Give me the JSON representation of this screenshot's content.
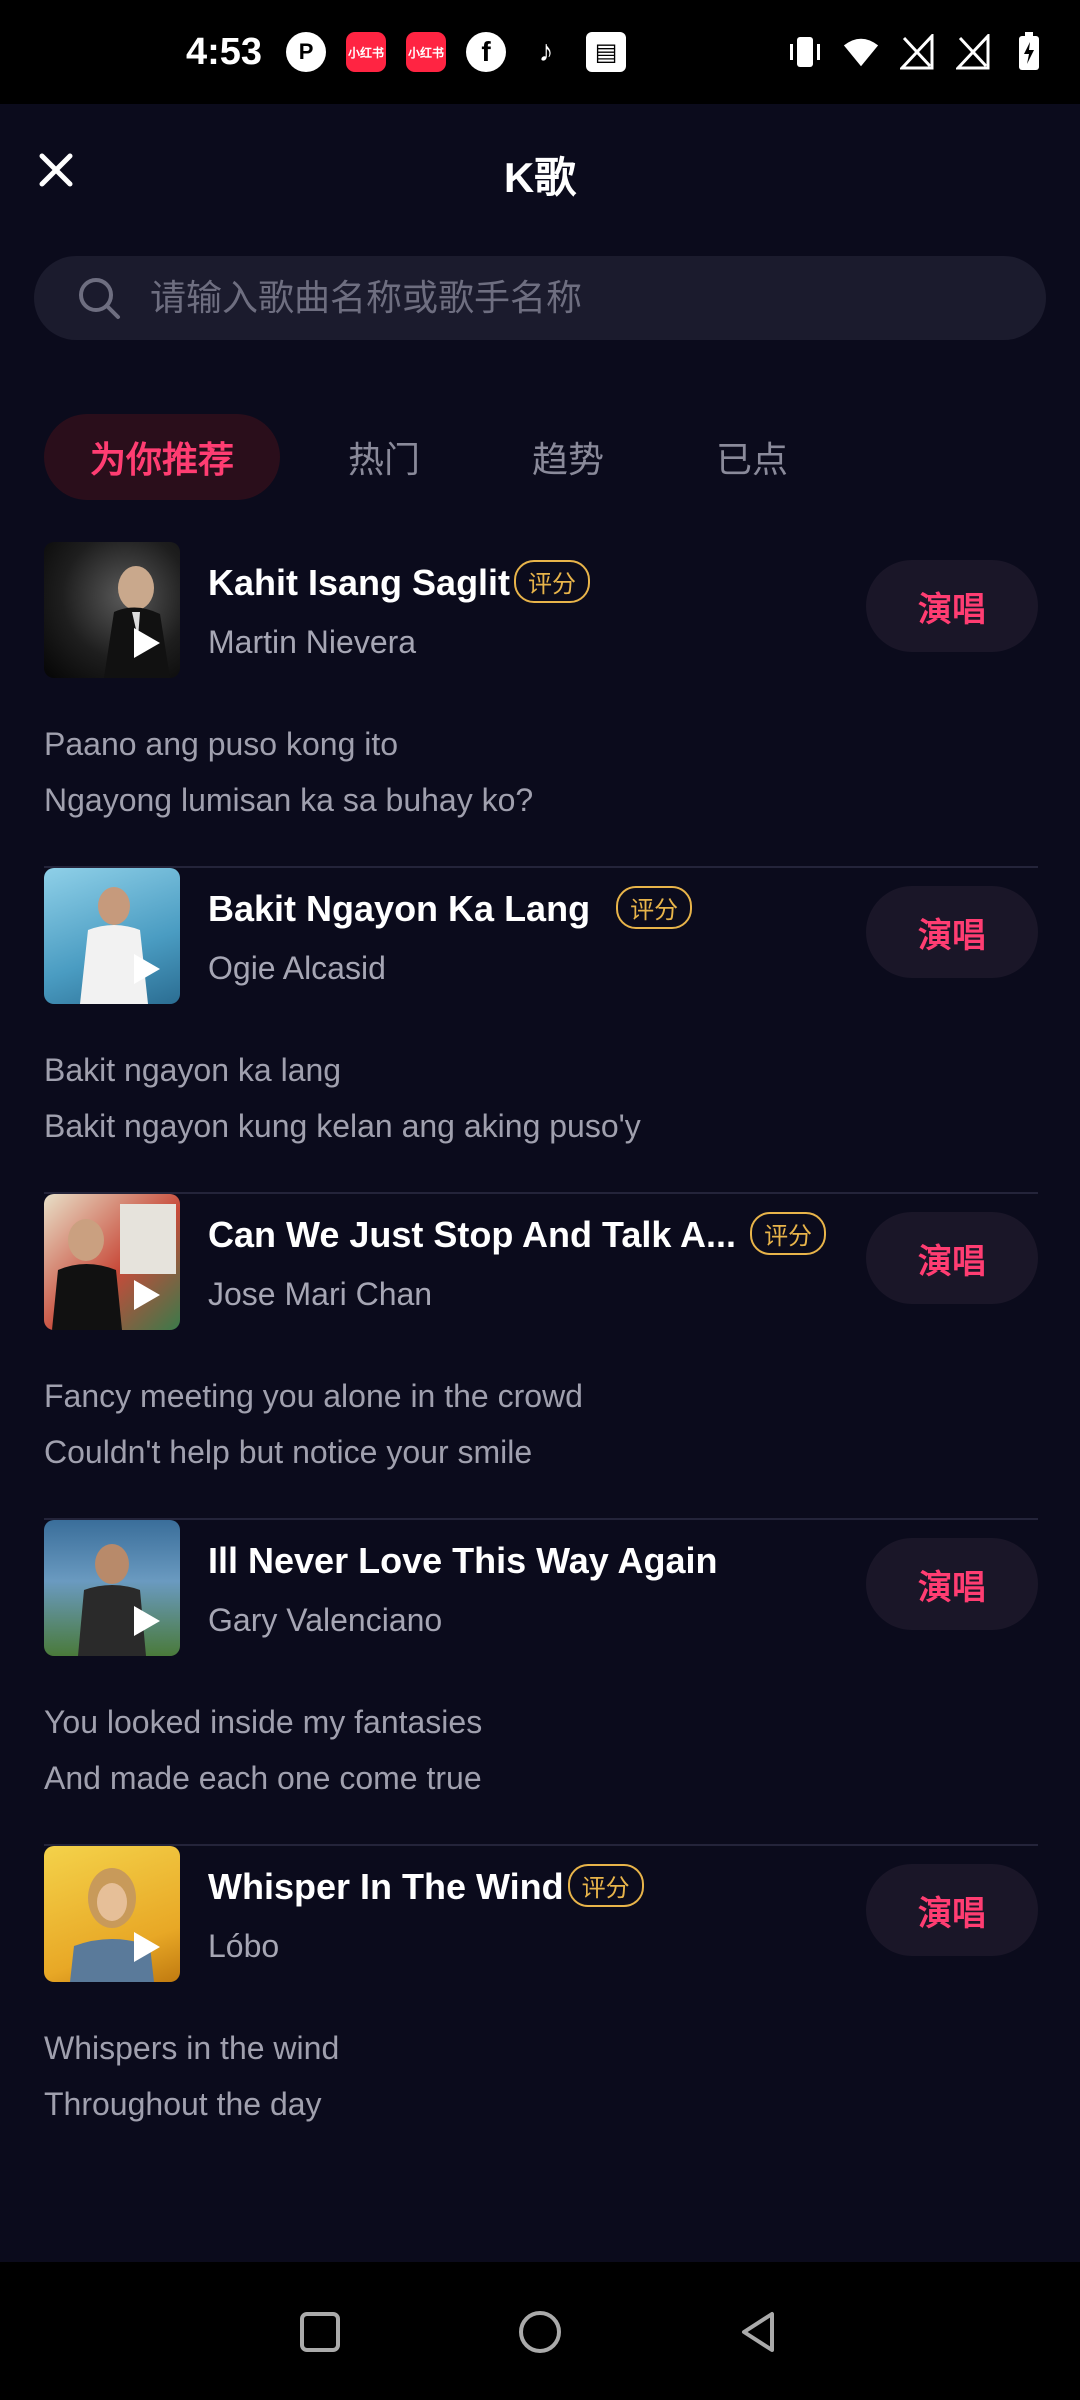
{
  "status_bar": {
    "time": "4:53",
    "left_icons": [
      "p-app-icon",
      "xiaohongshu-icon",
      "xiaohongshu-icon",
      "facebook-icon",
      "tiktok-icon",
      "app-box-icon"
    ],
    "right_icons": [
      "vibrate-icon",
      "wifi-icon",
      "signal-icon",
      "signal-icon",
      "battery-charging-icon"
    ],
    "xhs_label": "小红书"
  },
  "header": {
    "title": "K歌"
  },
  "search": {
    "placeholder": "请输入歌曲名称或歌手名称"
  },
  "tabs": [
    {
      "label": "为你推荐",
      "active": true
    },
    {
      "label": "热门",
      "active": false
    },
    {
      "label": "趋势",
      "active": false
    },
    {
      "label": "已点",
      "active": false
    }
  ],
  "songs": [
    {
      "title": "Kahit Isang Saglit",
      "artist": "Martin Nievera",
      "score_badge": "评分",
      "has_badge": true,
      "sing_label": "演唱",
      "lyric1": "Paano ang puso kong ito",
      "lyric2": "Ngayong lumisan ka sa buhay ko?"
    },
    {
      "title": "Bakit Ngayon Ka Lang",
      "artist": "Ogie Alcasid",
      "score_badge": "评分",
      "has_badge": true,
      "sing_label": "演唱",
      "lyric1": "Bakit ngayon ka lang",
      "lyric2": "Bakit ngayon kung kelan ang aking puso'y"
    },
    {
      "title": "Can We Just Stop And Talk A...",
      "artist": "Jose Mari Chan",
      "score_badge": "评分",
      "has_badge": true,
      "sing_label": "演唱",
      "lyric1": "Fancy meeting you alone in the crowd",
      "lyric2": "Couldn't help but notice your smile"
    },
    {
      "title": "Ill Never Love This Way Again",
      "artist": "Gary Valenciano",
      "score_badge": "",
      "has_badge": false,
      "sing_label": "演唱",
      "lyric1": "You looked inside my fantasies",
      "lyric2": "And made each one come true"
    },
    {
      "title": "Whisper In The Wind",
      "artist": "Lóbo",
      "score_badge": "评分",
      "has_badge": true,
      "sing_label": "演唱",
      "lyric1": "Whispers in the wind",
      "lyric2": "Throughout the day"
    }
  ],
  "colors": {
    "background": "#0b0b1c",
    "accent": "#ff3d72",
    "badge": "#e8b44a"
  }
}
